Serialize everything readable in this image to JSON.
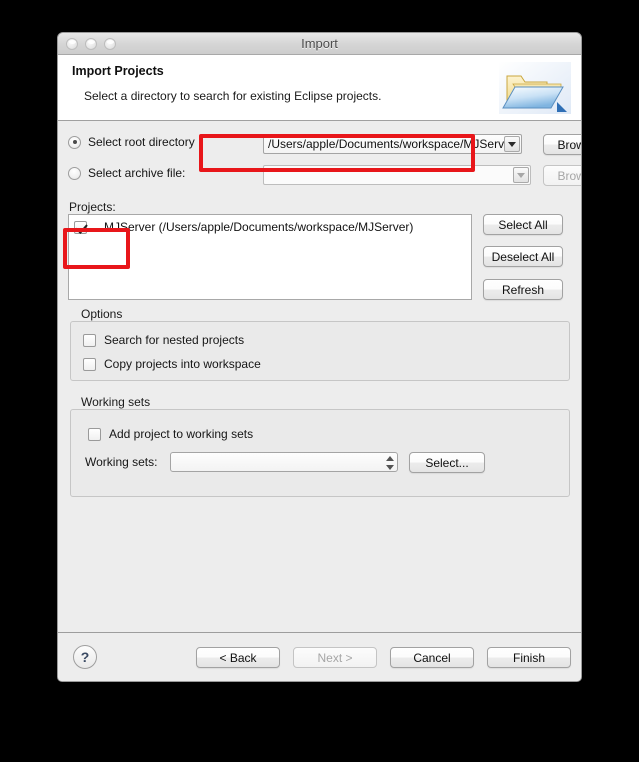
{
  "window": {
    "title": "Import",
    "traffic_lights": [
      "close-button",
      "minimize-button",
      "zoom-button"
    ]
  },
  "header": {
    "title": "Import Projects",
    "subtitle": "Select a directory to search for existing Eclipse projects.",
    "icon": "import-folder-icon"
  },
  "source": {
    "root_directory": {
      "radio_label": "Select root directory",
      "selected": true,
      "value": "/Users/apple/Documents/workspace/MJServe",
      "browse_label": "Browse...",
      "browse_enabled": true
    },
    "archive_file": {
      "radio_label": "Select archive file:",
      "selected": false,
      "value": "",
      "browse_label": "Browse...",
      "browse_enabled": false
    }
  },
  "projects": {
    "label": "Projects:",
    "items": [
      {
        "checked": true,
        "name": "MJServer (/Users/apple/Documents/workspace/MJServer)"
      }
    ],
    "buttons": {
      "select_all": "Select All",
      "deselect_all": "Deselect All",
      "refresh": "Refresh"
    }
  },
  "options": {
    "label": "Options",
    "checkboxes": [
      {
        "label": "Search for nested projects",
        "checked": false
      },
      {
        "label": "Copy projects into workspace",
        "checked": false
      }
    ]
  },
  "working_sets": {
    "label": "Working sets",
    "add_checkbox": {
      "label": "Add project to working sets",
      "checked": false
    },
    "combo_label": "Working sets:",
    "combo_value": "",
    "select_button": "Select..."
  },
  "footer": {
    "help": "?",
    "back": "< Back",
    "next": "Next >",
    "cancel": "Cancel",
    "finish": "Finish",
    "next_enabled": false
  },
  "annotations": {
    "highlight_color": "#e8161a",
    "boxes": [
      "root-directory-combo-highlight",
      "project-checkbox-highlight"
    ]
  }
}
